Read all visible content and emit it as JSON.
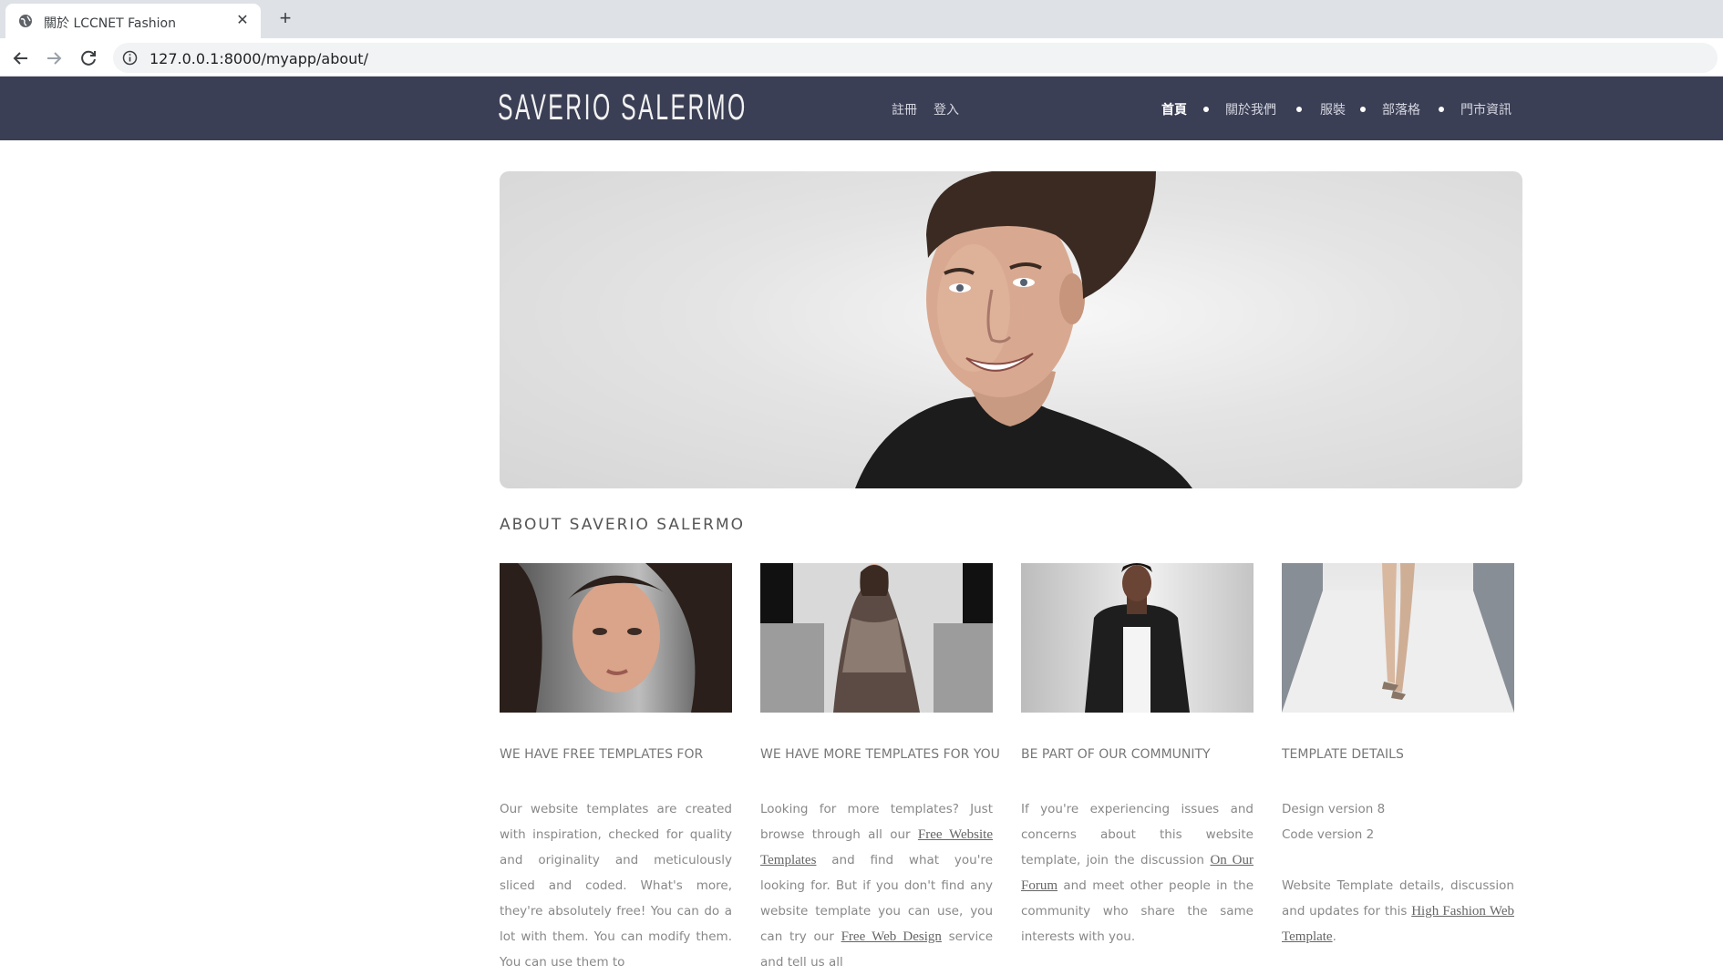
{
  "browser": {
    "tab_title": "關於 LCCNET Fashion",
    "tab_close": "✕",
    "new_tab": "+",
    "url": "127.0.0.1:8000/myapp/about/"
  },
  "header": {
    "logo": "SAVERIO SALERMO",
    "register": "註冊",
    "login": "登入",
    "nav": [
      "首頁",
      "關於我們",
      "服裝",
      "部落格",
      "門市資訊"
    ],
    "nav_active": "首頁"
  },
  "about_title": "ABOUT SAVERIO SALERMO",
  "columns": [
    {
      "heading": "WE HAVE FREE TEMPLATES FOR",
      "p1": "Our website templates are created with inspiration, checked for quality and originality and meticulously sliced and coded. What's more, they're absolutely free! You can do a lot with them. You can modify them. You can use them to"
    },
    {
      "heading": "WE HAVE MORE TEMPLATES FOR YOU",
      "p1_a": "Looking for more templates? Just browse through all our ",
      "link1": "Free Website Templates",
      "p1_b": " and find what you're looking for. But if you don't find any website template you can use, you can try our ",
      "link2": "Free Web Design",
      "p1_c": " service and tell us all"
    },
    {
      "heading": "BE PART OF OUR COMMUNITY",
      "p1_a": "If you're experiencing issues and concerns about this website template, join the discussion ",
      "link1": "On Our Forum",
      "p1_b": " and meet other people in the community who share the same interests with you."
    },
    {
      "heading": "TEMPLATE DETAILS",
      "line1": "Design version 8",
      "line2": "Code version 2",
      "p2_a": "Website Template details, discussion and updates for this ",
      "link1": "High Fashion Web Template",
      "p2_b": "."
    }
  ],
  "colors": {
    "header_bg": "#3b3f55",
    "tabbar_bg": "#dee1e6"
  }
}
